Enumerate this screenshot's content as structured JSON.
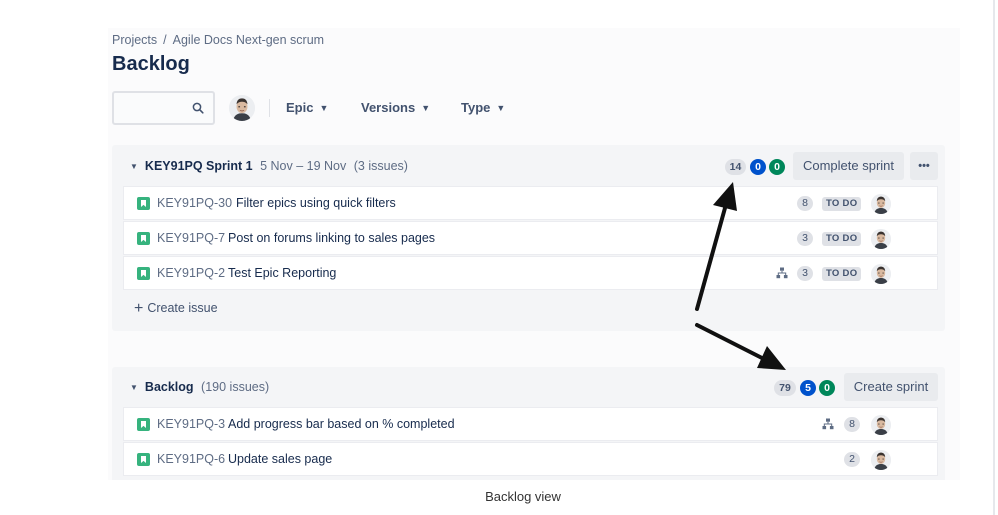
{
  "breadcrumb": {
    "projects": "Projects",
    "separator": "/",
    "project": "Agile Docs Next-gen scrum"
  },
  "page_title": "Backlog",
  "filters": {
    "search_value": "",
    "epic": "Epic",
    "versions": "Versions",
    "type": "Type"
  },
  "sprint": {
    "name": "KEY91PQ Sprint 1",
    "dates": "5 Nov – 19 Nov",
    "issue_count": "(3 issues)",
    "pill_todo": "14",
    "pill_in_progress": "0",
    "pill_done": "0",
    "complete_button": "Complete sprint",
    "more_button": "•••",
    "issues": [
      {
        "key": "KEY91PQ-30",
        "summary": "Filter epics using quick filters",
        "points": "8",
        "status": "TO DO",
        "has_hierarchy": false
      },
      {
        "key": "KEY91PQ-7",
        "summary": "Post on forums linking to sales pages",
        "points": "3",
        "status": "TO DO",
        "has_hierarchy": false
      },
      {
        "key": "KEY91PQ-2",
        "summary": "Test Epic Reporting",
        "points": "3",
        "status": "TO DO",
        "has_hierarchy": true
      }
    ],
    "create_issue": "Create issue"
  },
  "backlog": {
    "name": "Backlog",
    "issue_count": "(190 issues)",
    "pill_todo": "79",
    "pill_in_progress": "5",
    "pill_done": "0",
    "create_sprint_button": "Create sprint",
    "issues": [
      {
        "key": "KEY91PQ-3",
        "summary": "Add progress bar based on % completed",
        "points": "8",
        "has_hierarchy": true
      },
      {
        "key": "KEY91PQ-6",
        "summary": "Update sales page",
        "points": "2",
        "has_hierarchy": false
      }
    ]
  },
  "icons": {
    "search": "search-icon",
    "chevron": "chevron-down-icon",
    "story": "story-icon",
    "hierarchy": "child-issues-icon",
    "plus": "plus-icon",
    "avatar": "user-avatar"
  },
  "colors": {
    "blue_pill": "#0052cc",
    "green_pill": "#00875a",
    "story_green": "#36b37e",
    "text_primary": "#172b4d"
  },
  "caption": "Backlog view"
}
